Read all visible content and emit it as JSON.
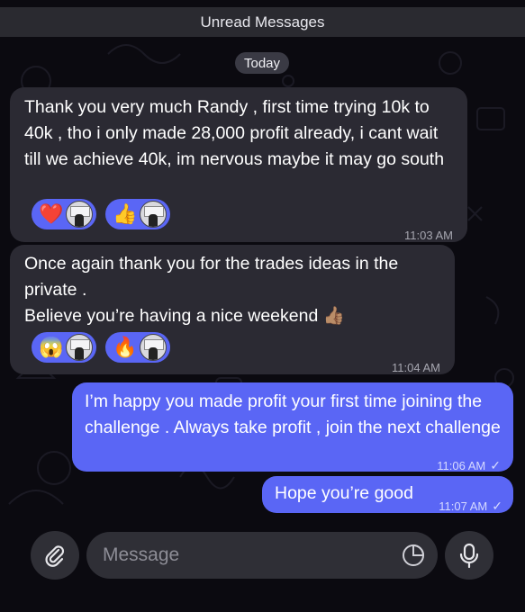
{
  "banner": {
    "unread_label": "Unread Messages"
  },
  "date_separator": "Today",
  "messages": [
    {
      "direction": "incoming",
      "text": "Thank you very much Randy , first time trying 10k to 40k , tho i only made 28,000 profit already, i cant wait till we achieve 40k, im nervous maybe it may go south",
      "time": "11:03 AM",
      "reactions": [
        {
          "emoji": "❤️",
          "icon": "red-heart"
        },
        {
          "emoji": "👍",
          "icon": "thumbs-up"
        }
      ]
    },
    {
      "direction": "incoming",
      "text": "Once again thank you for the trades ideas in the private .\nBelieve you’re having a nice weekend 👍🏽",
      "time": "11:04 AM",
      "reactions": [
        {
          "emoji": "😱",
          "icon": "screaming-face"
        },
        {
          "emoji": "🔥",
          "icon": "fire"
        }
      ]
    },
    {
      "direction": "outgoing",
      "text": "I’m happy you made profit your first time joining the challenge . Always take profit , join the next challenge",
      "time": "11:06 AM",
      "status": "read-check"
    },
    {
      "direction": "outgoing",
      "text": "Hope you’re good",
      "time": "11:07 AM",
      "status": "read-check"
    }
  ],
  "composer": {
    "placeholder": "Message",
    "attach_icon": "paperclip-icon",
    "sticker_icon": "sticker-icon",
    "mic_icon": "microphone-icon"
  },
  "colors": {
    "background": "#0b0a10",
    "incoming_bubble": "#2b2a33",
    "outgoing_bubble": "#5a66f5",
    "reaction_pill": "#5a66f5"
  }
}
